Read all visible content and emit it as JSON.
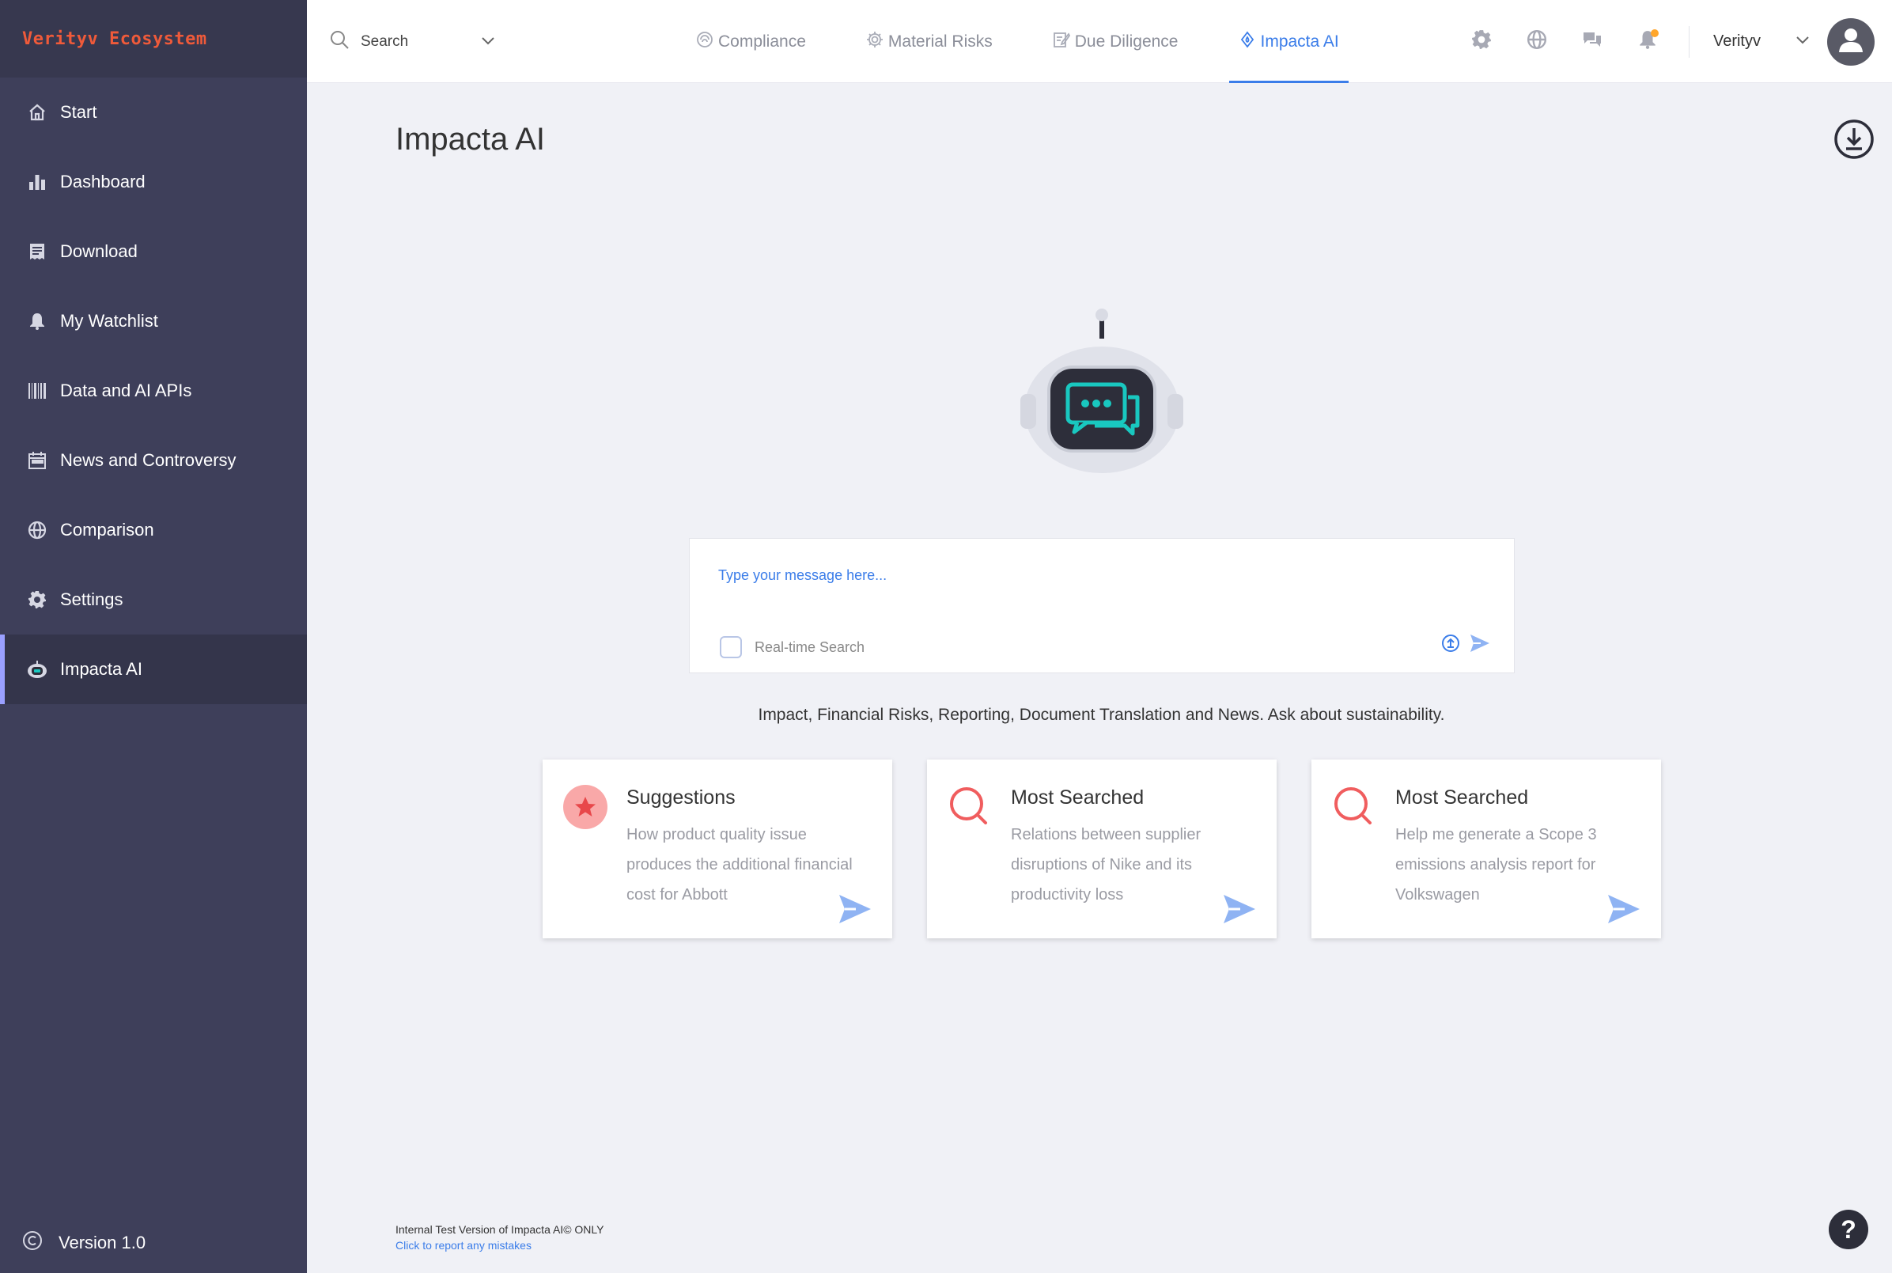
{
  "brand": "Verityv Ecosystem",
  "sidebar": {
    "items": [
      {
        "label": "Start",
        "icon": "home-icon"
      },
      {
        "label": "Dashboard",
        "icon": "bar-chart-icon"
      },
      {
        "label": "Download",
        "icon": "receipt-icon"
      },
      {
        "label": "My Watchlist",
        "icon": "bell-icon"
      },
      {
        "label": "Data and AI APIs",
        "icon": "barcode-icon"
      },
      {
        "label": "News and Controversy",
        "icon": "calendar-icon"
      },
      {
        "label": "Comparison",
        "icon": "globe-icon"
      },
      {
        "label": "Settings",
        "icon": "gear-icon"
      },
      {
        "label": "Impacta AI",
        "icon": "robot-icon",
        "active": true
      }
    ],
    "version": "Version 1.0"
  },
  "topbar": {
    "search_label": "Search",
    "tabs": [
      {
        "label": "Compliance",
        "icon": "compliance-icon"
      },
      {
        "label": "Material Risks",
        "icon": "gear-outline-icon"
      },
      {
        "label": "Due Diligence",
        "icon": "document-edit-icon"
      },
      {
        "label": "Impacta AI",
        "icon": "drop-icon",
        "active": true
      }
    ],
    "user_name": "Verityv"
  },
  "main": {
    "title": "Impacta AI",
    "chat": {
      "placeholder": "Type your message here...",
      "realtime_label": "Real-time Search"
    },
    "subtitle": "Impact, Financial Risks, Reporting, Document Translation and News. Ask about sustainability.",
    "cards": [
      {
        "title": "Suggestions",
        "text": "How product quality issue produces the additional financial cost for Abbott",
        "icon": "star-icon"
      },
      {
        "title": "Most Searched",
        "text": "Relations between supplier disruptions of Nike and its productivity loss",
        "icon": "magnifier-icon"
      },
      {
        "title": "Most Searched",
        "text": "Help me generate a Scope 3 emissions analysis report for Volkswagen",
        "icon": "magnifier-icon"
      }
    ],
    "footer_note": "Internal Test Version of Impacta AI© ONLY",
    "footer_link": "Click to report any mistakes"
  },
  "colors": {
    "sidebar_bg": "#3e3f5a",
    "brand": "#ef5a3a",
    "accent": "#3b7de9",
    "robot_screen": "#2d2e3a",
    "robot_glyph": "#19c8c0",
    "card_icon": "#f05d5e"
  }
}
